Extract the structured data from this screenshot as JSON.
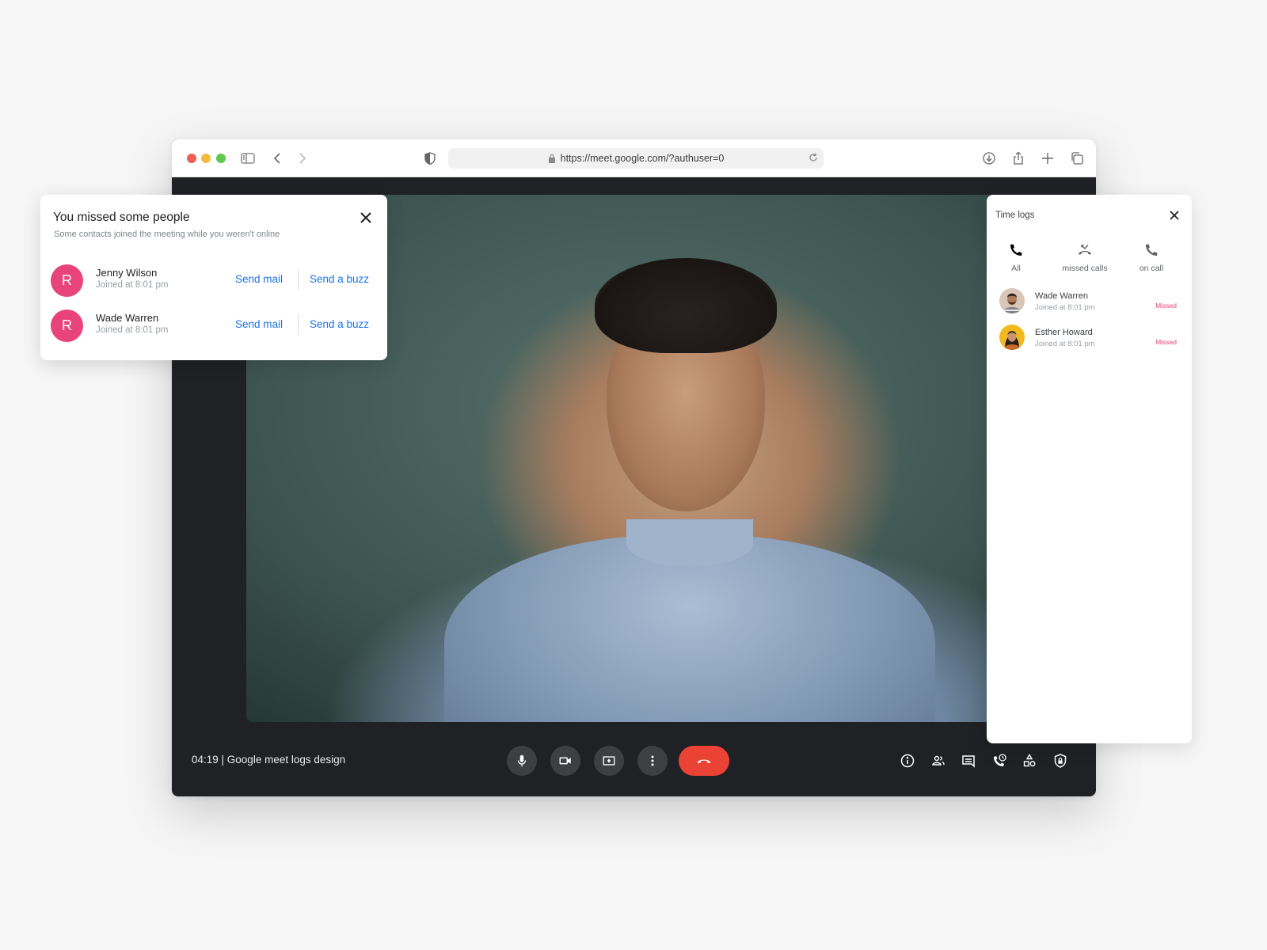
{
  "browser": {
    "url": "https://meet.google.com/?authuser=0",
    "icons": [
      "sidebar-icon",
      "back-icon",
      "forward-icon",
      "shield-icon",
      "lock-icon",
      "reload-icon",
      "download-icon",
      "share-icon",
      "new-tab-icon",
      "tabs-overview-icon"
    ]
  },
  "meeting": {
    "title": "04:19 | Google meet logs design",
    "controls": [
      "microphone",
      "camera",
      "present-screen",
      "more-options",
      "end-call"
    ],
    "side_controls": [
      "meeting-details",
      "people",
      "chat",
      "call-history",
      "activities",
      "host-controls"
    ],
    "end_call_color": "#ea4335"
  },
  "missed_card": {
    "title": "You missed some people",
    "subtitle": "Some contacts joined the meeting while you weren't online",
    "avatar_color": "#e8437a",
    "people": [
      {
        "initial": "R",
        "name": "Jenny Wilson",
        "joined": "Joined at 8:01 pm",
        "mail_label": "Send mail",
        "buzz_label": "Send a buzz"
      },
      {
        "initial": "R",
        "name": "Wade Warren",
        "joined": "Joined at 8:01 pm",
        "mail_label": "Send mail",
        "buzz_label": "Send a buzz"
      }
    ]
  },
  "time_logs": {
    "title": "Time logs",
    "tabs": [
      {
        "label": "All",
        "icon": "phone-icon"
      },
      {
        "label": "missed calls",
        "icon": "missed-call-icon"
      },
      {
        "label": "on call",
        "icon": "phone-icon"
      }
    ],
    "entries": [
      {
        "name": "Wade Warren",
        "joined": "Joined at 8:01 pm",
        "status": "Missed"
      },
      {
        "name": "Esther Howard",
        "joined": "Joined at 8:01 pm",
        "status": "Missed"
      }
    ],
    "status_color": "#e8437a"
  }
}
